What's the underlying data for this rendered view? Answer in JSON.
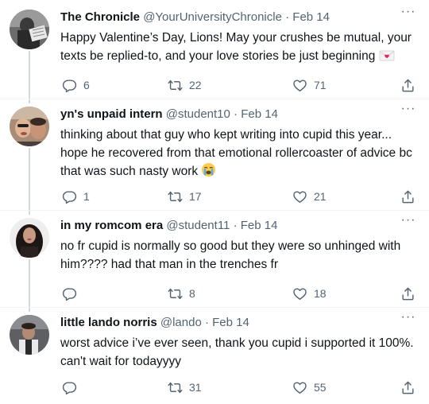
{
  "tweets": [
    {
      "name": "The Chronicle",
      "handle": "@YourUniversityChronicle",
      "date": "Feb 14",
      "text": "Happy Valentine’s Day, Lions! May your crushes be mutual, your texts be replied-to, and your love stories be just beginning",
      "emoji": "love-letter-emoji",
      "replies": "6",
      "retweets": "22",
      "likes": "71",
      "more": "···",
      "separator": "·"
    },
    {
      "name": "yn's unpaid intern",
      "handle": "@student10",
      "date": "Feb 14",
      "text": "thinking about that guy who kept writing into cupid this year... hope he recovered from that emotional rollercoaster of advice bc that was such nasty work",
      "emoji": "loudly-crying-face-emoji",
      "replies": "1",
      "retweets": "17",
      "likes": "21",
      "more": "···",
      "separator": "·"
    },
    {
      "name": "in my romcom era",
      "handle": "@student11",
      "date": "Feb 14",
      "text": "no fr cupid is normally so good but they were so unhinged with him???? had that man in the trenches fr",
      "replies": "",
      "retweets": "8",
      "likes": "18",
      "more": "···",
      "separator": "·"
    },
    {
      "name": "little lando norris",
      "handle": "@lando",
      "date": "Feb 14",
      "text": "worst advice i’ve ever seen, thank you cupid i supported it 100%. can't wait for todayyyy",
      "replies": "",
      "retweets": "31",
      "likes": "55",
      "more": "···",
      "separator": "·"
    }
  ],
  "icons": {
    "reply": "reply-icon",
    "retweet": "retweet-icon",
    "like": "heart-icon",
    "share": "share-icon",
    "more": "more-options-icon"
  },
  "colors": {
    "text": "#0f1419",
    "secondary": "#536471",
    "connector": "#cfd9de",
    "divider": "#eff3f4"
  }
}
